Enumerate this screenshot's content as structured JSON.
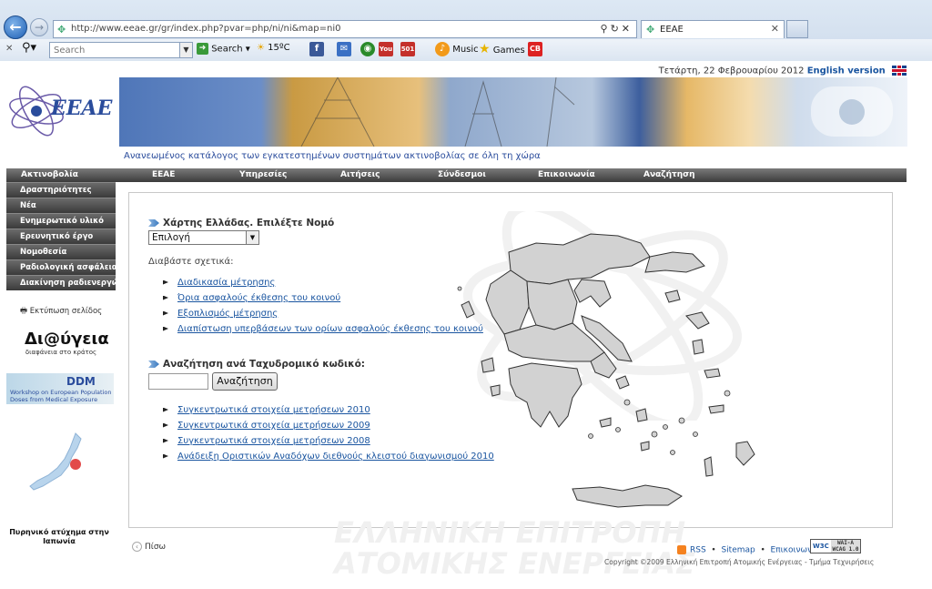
{
  "browser": {
    "url": "http://www.eeae.gr/gr/index.php?pvar=php/ni/ni&map=ni0",
    "tab_title": "ΕΕΑΕ",
    "search_placeholder": "Search",
    "toolbar": {
      "search_label": "Search",
      "weather": "15ºC",
      "music_label": "Music",
      "games_label": "Games"
    }
  },
  "header": {
    "date": "Τετάρτη, 22 Φεβρουαρίου 2012",
    "english_version": "English version",
    "logo_text": "ΕΕΑΕ",
    "tagline": "Ανανεωμένος κατάλογος των εγκατεστημένων συστημάτων ακτινοβολίας σε όλη τη χώρα"
  },
  "top_nav": [
    "Ακτινοβολία",
    "ΕΕΑΕ",
    "Υπηρεσίες",
    "Αιτήσεις",
    "Σύνδεσμοι",
    "Επικοινωνία",
    "Αναζήτηση"
  ],
  "side_nav": [
    "Δραστηριότητες",
    "Νέα",
    "Ενημερωτικό υλικό",
    "Ερευνητικό έργο",
    "Νομοθεσία",
    "Ραδιολογική ασφάλεια",
    "Διακίνηση ραδιενεργών"
  ],
  "sidebar": {
    "print_label": "Εκτύπωση σελίδος",
    "diavgeia_title": "Δι@ύγεια",
    "diavgeia_sub": "διαφάνεια στο κράτος",
    "ddm_logo": "DDM",
    "ddm_text": "Workshop on European Population Doses from Medical Exposure",
    "japan_caption": "Πυρηνικό ατύχημα στην Ιαπωνία"
  },
  "main": {
    "map_title": "Χάρτης Ελλάδας. Επιλέξτε Νομό",
    "select_value": "Επιλογή",
    "read_label": "Διαβάστε σχετικά:",
    "links1": [
      "Διαδικασία μέτρησης",
      "Όρια ασφαλούς έκθεσης του κοινού",
      "Εξοπλισμός μέτρησης",
      "Διαπίστωση υπερβάσεων των ορίων ασφαλούς έκθεσης του κοινού"
    ],
    "zip_title": "Αναζήτηση ανά Ταχυδρομικό κωδικό:",
    "zip_button": "Αναζήτηση",
    "links2": [
      "Συγκεντρωτικά στοιχεία μετρήσεων 2010",
      "Συγκεντρωτικά στοιχεία μετρήσεων 2009",
      "Συγκεντρωτικά στοιχεία μετρήσεων 2008",
      "Ανάδειξη Οριστικών Αναδόχων διεθνούς κλειστού διαγωνισμού 2010"
    ],
    "watermark_line1": "ΕΛΛΗΝΙΚΗ ΕΠΙΤΡΟΠΗ",
    "watermark_line2": "ΑΤΟΜΙΚΗΣ ΕΝΕΡΓΕΙΑΣ"
  },
  "footer": {
    "back_label": "Πίσω",
    "rss": "RSS",
    "sitemap": "Sitemap",
    "contact": "Επικοινωνία",
    "w3c": "W3C",
    "wcag": "WAI-A WCAG 1.0",
    "copyright": "Copyright ©2009 Ελληνική Επιτροπή Ατομικής Ενέργειας - Τμήμα Τεχνιρήσεις"
  }
}
